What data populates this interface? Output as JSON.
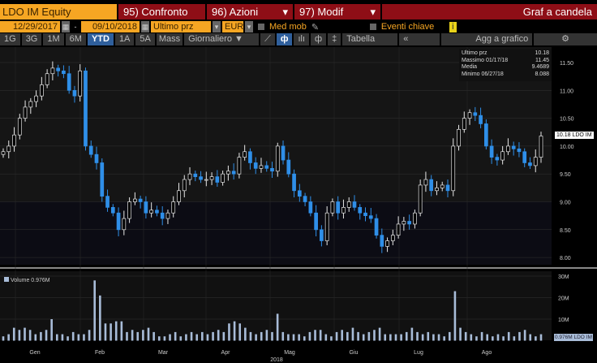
{
  "header": {
    "ticker": "LDO IM Equity",
    "compare": "95) Confronto",
    "actions": "96) Azioni",
    "modify": "97) Modif",
    "title": "Graf a candela"
  },
  "controls": {
    "start_date": "12/29/2017",
    "dash": "-",
    "end_date": "09/10/2018",
    "field": "Ultimo prz",
    "currency": "EUR",
    "moving_avg": "Med mob",
    "key_events": "Eventi chiave",
    "info": "i"
  },
  "toolbar": {
    "ranges": [
      "1G",
      "3G",
      "1M",
      "6M",
      "YTD",
      "1A",
      "5A",
      "Mass"
    ],
    "active": "YTD",
    "period": "Giornaliero ▼",
    "table": "Tabella",
    "collapse": "«",
    "add": "Agg a grafico",
    "settings": "⚙"
  },
  "legend": {
    "last_label": "Ultimo prz",
    "last": "10.18",
    "max_label": "Massimo 01/17/18",
    "max": "11.45",
    "avg_label": "Media",
    "avg": "9.4689",
    "min_label": "Minimo 06/27/18",
    "min": "8.088"
  },
  "price_tag": "10.18 LDO IM",
  "volume_label": "Volume 0.976M",
  "volume_tag": "0.976M LDO IM",
  "colors": {
    "up": "#e8e8e8",
    "down": "#2f8fe8",
    "volume": "#a8bcd8",
    "orange": "#f6a623",
    "red": "#8e0e16"
  },
  "chart_data": {
    "type": "candlestick",
    "y_ticks": [
      "11.50",
      "11.00",
      "10.50",
      "10.00",
      "9.50",
      "9.00",
      "8.50",
      "8.00"
    ],
    "ylim": [
      7.95,
      11.75
    ],
    "vol_ticks": [
      "30M",
      "20M",
      "10M"
    ],
    "months": [
      "Gen",
      "Feb",
      "Mar",
      "Apr",
      "Mag",
      "Giu",
      "Lug",
      "Ago"
    ],
    "year": "2018",
    "closes": [
      9.9,
      10.0,
      10.2,
      10.5,
      10.7,
      10.8,
      10.9,
      11.1,
      11.3,
      11.4,
      11.35,
      11.3,
      11.0,
      10.9,
      11.35,
      10.0,
      9.85,
      9.7,
      9.1,
      8.9,
      8.8,
      8.5,
      8.7,
      9.0,
      9.05,
      9.0,
      8.8,
      8.85,
      8.8,
      8.7,
      8.8,
      9.0,
      9.2,
      9.4,
      9.5,
      9.45,
      9.4,
      9.4,
      9.45,
      9.35,
      9.5,
      9.55,
      9.5,
      9.8,
      9.9,
      9.7,
      9.6,
      9.65,
      9.6,
      9.55,
      10.0,
      9.75,
      9.5,
      9.2,
      9.1,
      9.0,
      8.8,
      8.5,
      8.3,
      8.8,
      9.0,
      8.8,
      8.9,
      9.0,
      8.9,
      8.8,
      8.75,
      8.7,
      8.4,
      8.2,
      8.3,
      8.4,
      8.6,
      8.65,
      8.6,
      8.8,
      9.3,
      9.4,
      9.2,
      9.25,
      9.3,
      9.2,
      10.0,
      10.3,
      10.5,
      10.6,
      10.55,
      10.4,
      10.0,
      9.8,
      9.75,
      9.9,
      10.0,
      9.95,
      9.9,
      9.7,
      9.65,
      9.8,
      10.18
    ],
    "volumes_m": [
      2,
      3,
      6,
      5,
      6,
      5,
      3,
      4,
      5,
      10,
      3,
      3,
      2,
      4,
      3,
      3,
      5,
      28,
      21,
      8,
      8,
      9,
      9,
      4,
      5,
      4,
      5,
      6,
      4,
      2,
      2,
      3,
      4,
      2,
      3,
      4,
      3,
      4,
      3,
      4,
      5,
      4,
      8,
      9,
      8,
      6,
      4,
      3,
      4,
      5,
      4,
      3,
      4,
      3,
      3,
      3,
      2,
      4,
      5,
      5,
      3,
      2,
      4,
      5,
      4,
      6,
      4,
      3,
      4,
      5,
      6,
      3,
      3,
      3,
      3,
      4,
      6,
      4,
      3,
      4,
      3,
      3,
      2,
      4,
      9,
      6,
      4,
      3,
      2,
      4,
      3,
      2,
      3,
      2,
      4,
      2,
      4,
      5,
      3,
      2,
      3
    ],
    "volume_spike_extra": {
      "index_mag": 12.5,
      "index_lug": 23
    }
  }
}
